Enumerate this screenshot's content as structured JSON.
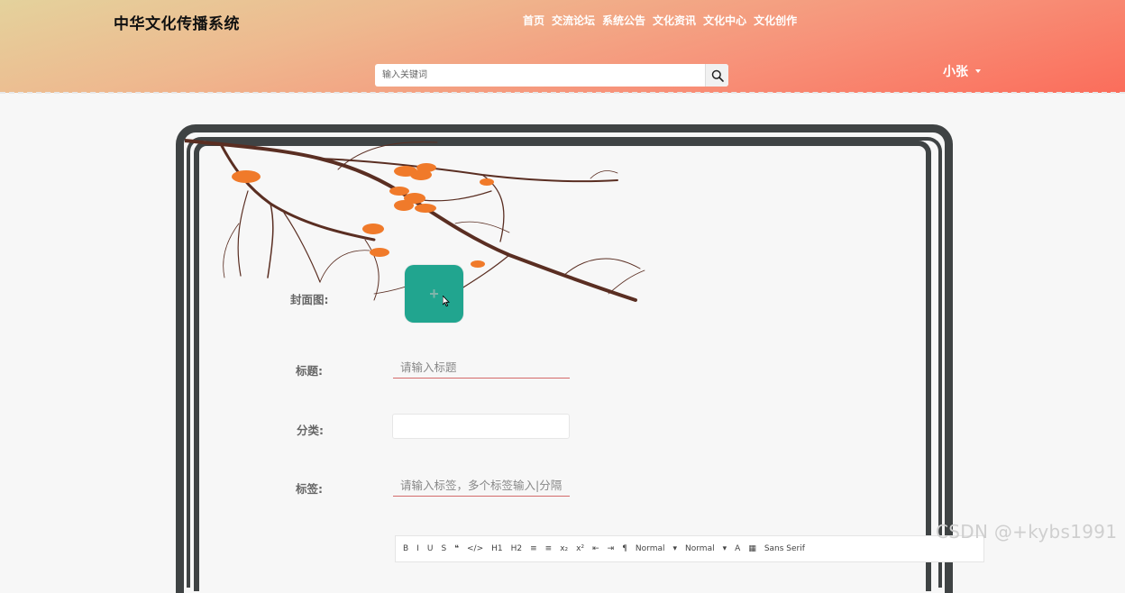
{
  "header": {
    "site_title": "中华文化传播系统",
    "nav": [
      "首页",
      "交流论坛",
      "系统公告",
      "文化资讯",
      "文化中心",
      "文化创作"
    ],
    "search": {
      "placeholder": "输入关键词",
      "icon": "search-icon"
    },
    "user": {
      "name": "小张",
      "icon": "caret-down-icon"
    }
  },
  "form": {
    "cover": {
      "label": "封面图:",
      "icon": "plus-icon",
      "plus_glyph": "+"
    },
    "title": {
      "label": "标题:",
      "placeholder": "请输入标题"
    },
    "category": {
      "label": "分类:",
      "value": ""
    },
    "tags": {
      "label": "标签:",
      "placeholder": "请输入标签，多个标签输入|分隔"
    },
    "editor_toolbar": [
      "B",
      "I",
      "U",
      "S",
      "❝",
      "</>",
      "H1",
      "H2",
      "≡",
      "≡",
      "x₂",
      "x²",
      "⇤",
      "⇥",
      "¶",
      "Normal",
      "▾",
      "Normal",
      "▾",
      "A",
      "▦",
      "Sans Serif"
    ]
  },
  "watermark": "CSDN @+kybs1991",
  "colors": {
    "accent_green": "#21a58f",
    "frame": "#3f4344",
    "header_gradient_start": "#e4d29c",
    "header_gradient_end": "#fb6d5b",
    "underline": "#d46a6a"
  }
}
